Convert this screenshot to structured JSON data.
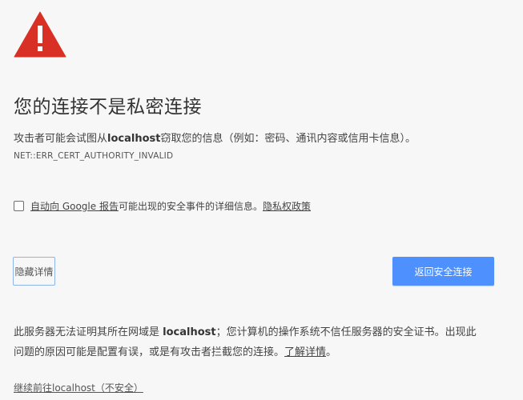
{
  "icon": {
    "name": "warning-triangle-icon",
    "color": "#d93025"
  },
  "heading": "您的连接不是私密连接",
  "description": {
    "before": "攻击者可能会试图从",
    "host": "localhost",
    "after": "窃取您的信息（例如：密码、通讯内容或信用卡信息）。"
  },
  "error_code": "NET::ERR_CERT_AUTHORITY_INVALID",
  "opt_in": {
    "checked": false,
    "link_label": "自动向 Google 报告",
    "text": "可能出现的安全事件的详细信息。",
    "privacy_link": "隐私权政策"
  },
  "buttons": {
    "details_label": "隐藏详情",
    "back_label": "返回安全连接",
    "primary_color": "#4d90fe"
  },
  "explanation": {
    "before": "此服务器无法证明其所在网域是 ",
    "host": "localhost",
    "after": "；您计算机的操作系统不信任服务器的安全证书。出现此问题的原因可能是配置有误，或是有攻击者拦截您的连接。",
    "learn_more": "了解详情",
    "end": "。"
  },
  "proceed_link": "继续前往localhost（不安全）"
}
